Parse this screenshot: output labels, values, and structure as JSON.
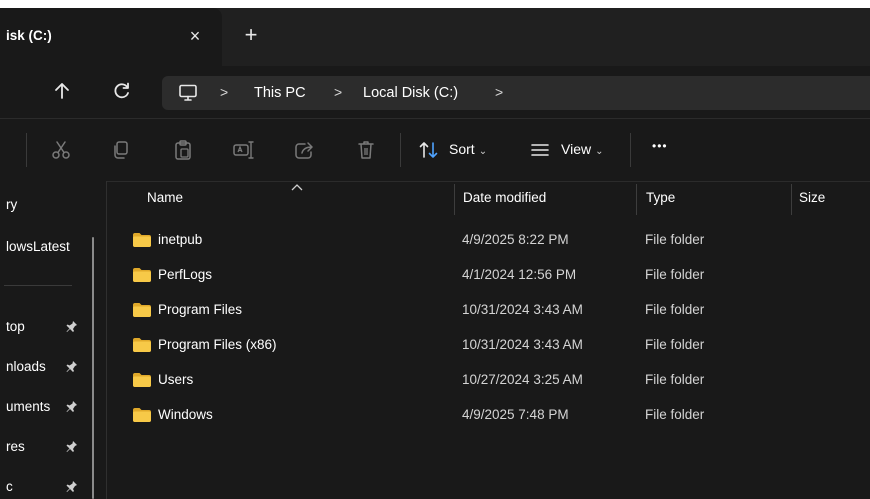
{
  "tab": {
    "title": "isk (C:)",
    "close_glyph": "×",
    "newtab_glyph": "+"
  },
  "breadcrumb": {
    "items": [
      "This PC",
      "Local Disk (C:)"
    ],
    "separator": ">"
  },
  "commands": {
    "sort_label": "Sort",
    "view_label": "View",
    "more_label": "•••"
  },
  "nav_pane": {
    "items": [
      {
        "label": "ry",
        "pinned": false
      },
      {
        "label": "lowsLatest",
        "pinned": false
      },
      {
        "label": "top",
        "pinned": true
      },
      {
        "label": "nloads",
        "pinned": true
      },
      {
        "label": "uments",
        "pinned": true
      },
      {
        "label": "res",
        "pinned": true
      },
      {
        "label": "c",
        "pinned": true
      }
    ]
  },
  "columns": {
    "name": "Name",
    "date": "Date modified",
    "type": "Type",
    "size": "Size"
  },
  "files": [
    {
      "name": "inetpub",
      "date": "4/9/2025 8:22 PM",
      "type": "File folder"
    },
    {
      "name": "PerfLogs",
      "date": "4/1/2024 12:56 PM",
      "type": "File folder"
    },
    {
      "name": "Program Files",
      "date": "10/31/2024 3:43 AM",
      "type": "File folder"
    },
    {
      "name": "Program Files (x86)",
      "date": "10/31/2024 3:43 AM",
      "type": "File folder"
    },
    {
      "name": "Users",
      "date": "10/27/2024 3:25 AM",
      "type": "File folder"
    },
    {
      "name": "Windows",
      "date": "4/9/2025 7:48 PM",
      "type": "File folder"
    }
  ],
  "colors": {
    "folder": "#f7c948",
    "folder_dark": "#e0a92a",
    "background": "#191919",
    "address_bg": "#2c2c2c"
  }
}
